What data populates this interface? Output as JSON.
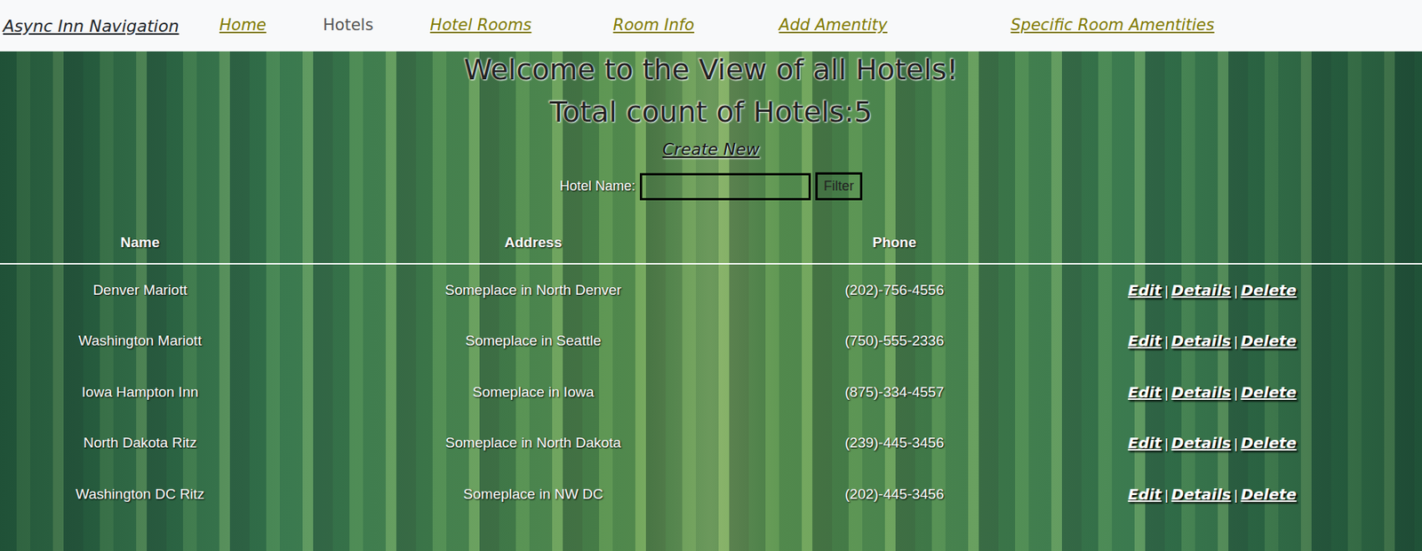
{
  "nav": {
    "brand": "Async Inn Navigation",
    "links": [
      {
        "label": "Home",
        "selected": false
      },
      {
        "label": "Hotels",
        "selected": true
      },
      {
        "label": "Hotel Rooms",
        "selected": false
      },
      {
        "label": "Room Info",
        "selected": false
      },
      {
        "label": "Add Amentity",
        "selected": false
      },
      {
        "label": "Specific Room Amentities",
        "selected": false
      }
    ]
  },
  "page": {
    "title": "Welcome to the View of all Hotels!",
    "count": "Total count of Hotels:5",
    "create": "Create New"
  },
  "filter": {
    "label": "Hotel Name:",
    "value": "",
    "button": "Filter"
  },
  "table": {
    "columns": [
      "Name",
      "Address",
      "Phone"
    ],
    "rows": [
      [
        "Denver Mariott",
        "Someplace in North Denver",
        "(202)-756-4556"
      ],
      [
        "Washington Mariott",
        "Someplace in Seattle",
        "(750)-555-2336"
      ],
      [
        "Iowa Hampton Inn",
        "Someplace in Iowa",
        "(875)-334-4557"
      ],
      [
        "North Dakota Ritz",
        "Someplace in North Dakota",
        "(239)-445-3456"
      ],
      [
        "Washington DC Ritz",
        "Someplace in NW DC",
        "(202)-445-3456"
      ]
    ],
    "actions": [
      "Edit",
      "Details",
      "Delete"
    ],
    "separator": "|"
  }
}
